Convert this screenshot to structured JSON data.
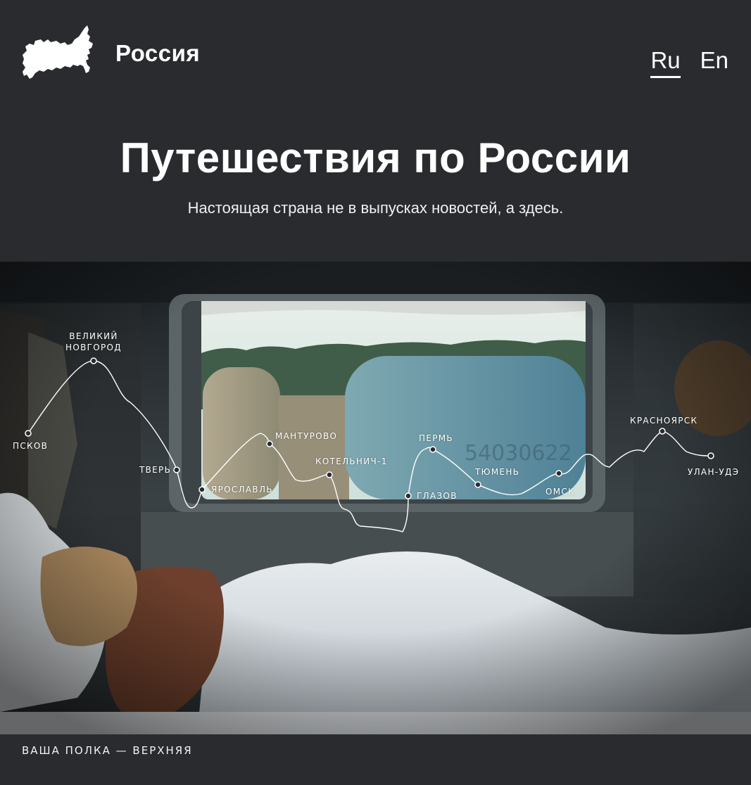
{
  "header": {
    "logo_text": "Россия",
    "logo_icon": "russia-map-icon",
    "languages": [
      {
        "label": "Ru",
        "active": true
      },
      {
        "label": "En",
        "active": false
      }
    ]
  },
  "hero": {
    "title": "Путешествия по России",
    "subtitle": "Настоящая страна не в выпусках новостей, а здесь."
  },
  "route": {
    "stations": [
      {
        "id": "pskov",
        "label": "ПСКОВ"
      },
      {
        "id": "veliky-novgorod",
        "label": "ВЕЛИКИЙ\nНОВГОРОД"
      },
      {
        "id": "tver",
        "label": "ТВЕРЬ"
      },
      {
        "id": "yaroslavl",
        "label": "ЯРОСЛАВЛЬ"
      },
      {
        "id": "manturovo",
        "label": "МАНТУРОВО"
      },
      {
        "id": "kotelnich",
        "label": "КОТЕЛЬНИЧ-1"
      },
      {
        "id": "glazov",
        "label": "ГЛАЗОВ"
      },
      {
        "id": "perm",
        "label": "ПЕРМЬ"
      },
      {
        "id": "tyumen",
        "label": "ТЮМЕНЬ"
      },
      {
        "id": "omsk",
        "label": "ОМСК"
      },
      {
        "id": "krasnoyarsk",
        "label": "КРАСНОЯРСК"
      },
      {
        "id": "ulan-ude",
        "label": "УЛАН-УДЭ"
      }
    ]
  },
  "caption": {
    "text": "ВАША ПОЛКА — ВЕРХНЯЯ"
  },
  "colors": {
    "background": "#2a2b2f",
    "text": "#ffffff"
  }
}
